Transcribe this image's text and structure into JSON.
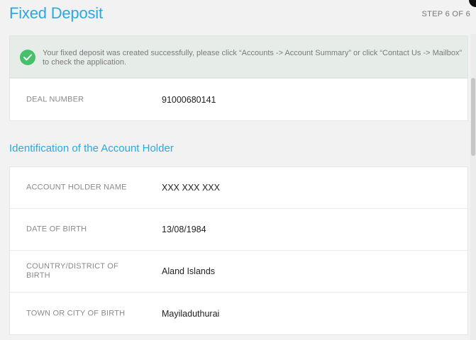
{
  "header": {
    "title": "Fixed Deposit",
    "step": "STEP 6 OF 6"
  },
  "success": {
    "icon": "check-circle-icon",
    "color": "#46c06a",
    "message": "Your fixed deposit was created successfully, please click “Accounts -> Account Summary” or click “Contact Us -> Mailbox” to check the application."
  },
  "deal": {
    "label": "DEAL NUMBER",
    "value": "91000680141"
  },
  "holder_section": {
    "title": "Identification of the Account Holder",
    "rows": [
      {
        "label": "ACCOUNT HOLDER NAME",
        "value": "XXX XXX XXX"
      },
      {
        "label": "DATE OF BIRTH",
        "value": "13/08/1984"
      },
      {
        "label": "COUNTRY/DISTRICT OF BIRTH",
        "value": "Aland Islands"
      },
      {
        "label": "TOWN OR CITY OF BIRTH",
        "value": "Mayiladuthurai"
      }
    ]
  },
  "colors": {
    "accent": "#2aa9e0",
    "success_bg": "#e6ede9"
  }
}
